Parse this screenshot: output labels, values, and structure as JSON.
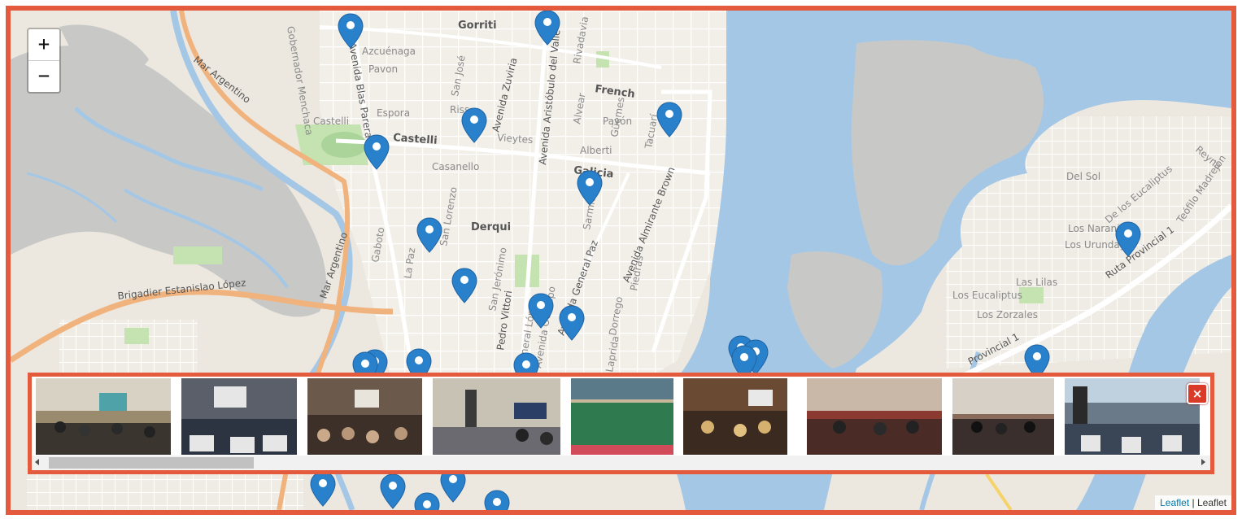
{
  "map": {
    "streets": {
      "gorriti": "Gorriti",
      "azcuenaga": "Azcuénaga",
      "pavon": "Pavon",
      "pavon2": "Pavón",
      "french": "French",
      "castelli": "Castelli",
      "castelli_main": "Castelli",
      "espora": "Espora",
      "vieytes": "Vieytes",
      "alvear": "Alvear",
      "guemes": "Güemes",
      "alberti": "Alberti",
      "tacuari": "Tacuarí",
      "galicia": "Galicia",
      "casanello": "Casanello",
      "derqui": "Derqui",
      "san_lorenzo": "San Lorenzo",
      "san_jose": "San José",
      "rivadavia": "Rivadavia",
      "riss": "Riss",
      "zuviria": "Avenida Zuviria",
      "aristobulo": "Avenida Aristóbulo del Valle",
      "blas_parera": "Avenida Blas Parera",
      "menchaca": "Gobernador Menchaca",
      "mar_argentino_1": "Mar Argentino",
      "mar_argentino_2": "Mar Argentino",
      "brigadier": "Brigadier Estanislao López",
      "gaboto": "Gaboto",
      "la_paz": "La Paz",
      "san_jeronimo": "San Jerónimo",
      "pedro_vittori": "Pedro Vittori",
      "sarmiento": "Sarmiento",
      "general_paz": "Avenida General Paz",
      "almirante_brown": "Avenida Almirante Brown",
      "dorrego": "Dorrego",
      "piedras": "Piedras",
      "laprida": "Laprida",
      "ocampo": "Avenida Ocampo",
      "general_lopez": "General López",
      "del_sol": "Del Sol",
      "eucaliptus_1": "De los Eucaliptus",
      "teofilo": "Teófilo Madrejón",
      "ruta_1": "Ruta Provincial 1",
      "ruta_1_b": "Provincial 1",
      "los_naranjos": "Los Naranjos",
      "los_urunday": "Los Urunday",
      "las_lilas": "Las Lilas",
      "los_eucaliptus": "Los Eucaliptus",
      "los_zorzales": "Los Zorzales",
      "reyna": "Reyna"
    }
  },
  "zoom": {
    "in_label": "+",
    "out_label": "−"
  },
  "gallery": {
    "close_label": "×",
    "photos": [
      {
        "subject": "classroom-presentation-photo"
      },
      {
        "subject": "students-seated-photo"
      },
      {
        "subject": "auditorium-crowd-photo"
      },
      {
        "subject": "teacher-speaking-photo"
      },
      {
        "subject": "school-assembly-photo"
      },
      {
        "subject": "classroom-audience-photo"
      },
      {
        "subject": "students-at-desks-photo"
      },
      {
        "subject": "classroom-group-photo"
      },
      {
        "subject": "speaker-with-students-photo"
      }
    ]
  },
  "attribution": {
    "link": "Leaflet",
    "separator": "|",
    "text": "Leaflet"
  },
  "colors": {
    "frame_border": "#e35a3c",
    "water": "#a5c7e6",
    "land": "#ece8df",
    "marker": "#2a81cb"
  }
}
